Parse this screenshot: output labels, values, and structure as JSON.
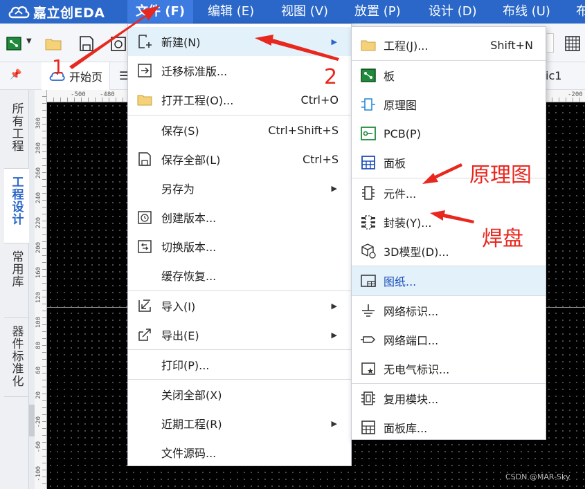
{
  "app": {
    "logo_text": "嘉立创EDA"
  },
  "menubar": [
    {
      "label": "文件 (F)",
      "active": true
    },
    {
      "label": "编辑 (E)"
    },
    {
      "label": "视图 (V)"
    },
    {
      "label": "放置 (P)"
    },
    {
      "label": "设计 (D)"
    },
    {
      "label": "布线 (U)"
    },
    {
      "label": "布"
    }
  ],
  "tabs": {
    "start": "开始页",
    "schematic_partial": "ic1"
  },
  "sidebar": [
    {
      "label": "所有工程"
    },
    {
      "label": "工程设计",
      "active": true
    },
    {
      "label": "常用库"
    },
    {
      "label": "器件标准化"
    }
  ],
  "ruler": {
    "h_labels": [
      "-500",
      "-480",
      "-200"
    ],
    "v_labels": [
      "300",
      "280",
      "260",
      "240",
      "220",
      "200",
      "160",
      "120",
      "100",
      "80",
      "60",
      "20",
      "-20",
      "-60",
      "-100"
    ]
  },
  "file_menu": {
    "items": [
      {
        "label": "新建(N)",
        "shortcut": "",
        "submenu": true,
        "highlight": true,
        "icon": "new-file-icon"
      },
      {
        "label": "迁移标准版...",
        "shortcut": "",
        "icon": "migrate-icon"
      },
      {
        "label": "打开工程(O)...",
        "shortcut": "Ctrl+O",
        "icon": "folder-icon"
      },
      {
        "label": "保存(S)",
        "shortcut": "Ctrl+Shift+S",
        "icon": ""
      },
      {
        "label": "保存全部(L)",
        "shortcut": "Ctrl+S",
        "icon": "save-all-icon"
      },
      {
        "label": "另存为",
        "shortcut": "",
        "submenu": true,
        "icon": ""
      },
      {
        "label": "创建版本...",
        "shortcut": "",
        "icon": "create-version-icon"
      },
      {
        "label": "切换版本...",
        "shortcut": "",
        "icon": "switch-version-icon"
      },
      {
        "label": "缓存恢复...",
        "shortcut": "",
        "icon": ""
      },
      {
        "label": "导入(I)",
        "shortcut": "",
        "submenu": true,
        "icon": "import-icon"
      },
      {
        "label": "导出(E)",
        "shortcut": "",
        "submenu": true,
        "icon": "export-icon"
      },
      {
        "label": "打印(P)...",
        "shortcut": "",
        "icon": ""
      },
      {
        "label": "关闭全部(X)",
        "shortcut": "",
        "icon": ""
      },
      {
        "label": "近期工程(R)",
        "shortcut": "",
        "submenu": true,
        "icon": ""
      },
      {
        "label": "文件源码...",
        "shortcut": "",
        "icon": ""
      }
    ]
  },
  "new_menu": {
    "items": [
      {
        "label": "工程(J)...",
        "shortcut": "Shift+N",
        "icon": "folder-icon"
      },
      {
        "label": "板",
        "icon": "board-icon"
      },
      {
        "label": "原理图",
        "icon": "schematic-icon"
      },
      {
        "label": "PCB(P)",
        "icon": "pcb-icon"
      },
      {
        "label": "面板",
        "icon": "panel-icon"
      },
      {
        "label": "元件...",
        "icon": "component-icon"
      },
      {
        "label": "封装(Y)...",
        "icon": "footprint-icon"
      },
      {
        "label": "3D模型(D)...",
        "icon": "3d-model-icon"
      },
      {
        "label": "图纸...",
        "icon": "drawing-sheet-icon",
        "highlight": true
      },
      {
        "label": "网络标识...",
        "icon": "net-label-icon"
      },
      {
        "label": "网络端口...",
        "icon": "net-port-icon"
      },
      {
        "label": "无电气标识...",
        "icon": "non-electrical-icon"
      },
      {
        "label": "复用模块...",
        "icon": "reuse-module-icon"
      },
      {
        "label": "面板库...",
        "icon": "panel-library-icon"
      }
    ]
  },
  "annotations": {
    "step1": "1",
    "step2": "2",
    "schematic_note": "原理图",
    "pad_note": "焊盘",
    "color": "#e8281f"
  },
  "watermark": "CSDN @MAR-Sky",
  "colors": {
    "menubar": "#2a67c8",
    "accent": "#2a67c8",
    "highlight": "#e3f1fb"
  }
}
